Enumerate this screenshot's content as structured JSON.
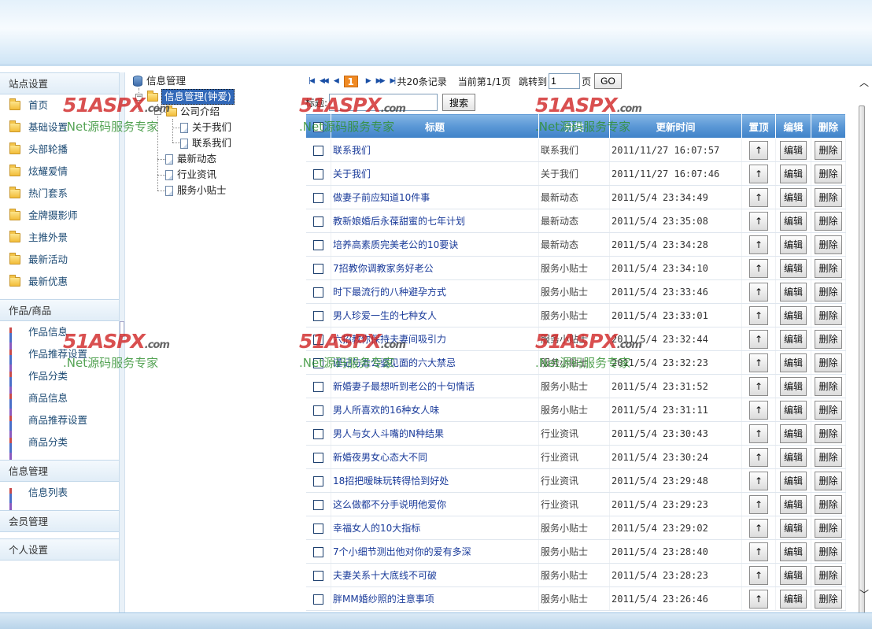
{
  "sidebar": {
    "sections": [
      {
        "title": "站点设置",
        "icon": "folder-icon",
        "items": [
          "首页",
          "基础设置",
          "头部轮播",
          "炫耀爱情",
          "热门套系",
          "金牌摄影师",
          "主推外景",
          "最新活动",
          "最新优惠"
        ]
      },
      {
        "title": "作品/商品",
        "icon": "bar-chart-icon",
        "items": [
          "作品信息",
          "作品推荐设置",
          "作品分类",
          "商品信息",
          "商品推荐设置",
          "商品分类"
        ]
      },
      {
        "title": "信息管理",
        "icon": "bar-chart-icon",
        "items": [
          "信息列表"
        ]
      },
      {
        "title": "会员管理",
        "items": []
      },
      {
        "title": "个人设置",
        "items": []
      }
    ]
  },
  "tree": {
    "root": "信息管理",
    "selected": "信息管理(钟爱)",
    "folder": "公司介绍",
    "folder_children": [
      "关于我们",
      "联系我们"
    ],
    "others": [
      "最新动态",
      "行业资讯",
      "服务小贴士"
    ]
  },
  "pager": {
    "first": "⏮",
    "prev_all": "◀◀",
    "prev": "◀",
    "current": "1",
    "next": "▶",
    "next_all": "▶▶",
    "last": "⏭",
    "total": "共20条记录",
    "current_text": "当前第1/1页",
    "jump_label": "跳转到",
    "jump_value": "1",
    "page_unit": "页",
    "go": "GO"
  },
  "search": {
    "label": "标题:",
    "value": "",
    "button": "搜索"
  },
  "table": {
    "headers": [
      "",
      "标题",
      "分类",
      "更新时间",
      "置顶",
      "编辑",
      "删除"
    ],
    "up_label": "↑",
    "edit_label": "编辑",
    "delete_label": "删除",
    "rows": [
      {
        "title": "联系我们",
        "category": "联系我们",
        "time": "2011/11/27 16:07:57"
      },
      {
        "title": "关于我们",
        "category": "关于我们",
        "time": "2011/11/27 16:07:46"
      },
      {
        "title": "做妻子前应知道10件事",
        "category": "最新动态",
        "time": "2011/5/4 23:34:49"
      },
      {
        "title": "教新娘婚后永葆甜蜜的七年计划",
        "category": "最新动态",
        "time": "2011/5/4 23:35:08"
      },
      {
        "title": "培养高素质完美老公的10要诀",
        "category": "最新动态",
        "time": "2011/5/4 23:34:28"
      },
      {
        "title": "7招教你调教家务好老公",
        "category": "服务小贴士",
        "time": "2011/5/4 23:34:10"
      },
      {
        "title": "时下最流行的八种避孕方式",
        "category": "服务小贴士",
        "time": "2011/5/4 23:33:46"
      },
      {
        "title": "男人珍爱一生的七种女人",
        "category": "服务小贴士",
        "time": "2011/5/4 23:33:01"
      },
      {
        "title": "六招教你保持夫妻间吸引力",
        "category": "服务小贴士",
        "time": "2011/5/4 23:32:44"
      },
      {
        "title": "谨记与准公婆见面的六大禁忌",
        "category": "服务小贴士",
        "time": "2011/5/4 23:32:23"
      },
      {
        "title": "新婚妻子最想听到老公的十句情话",
        "category": "服务小贴士",
        "time": "2011/5/4 23:31:52"
      },
      {
        "title": "男人所喜欢的16种女人味",
        "category": "服务小贴士",
        "time": "2011/5/4 23:31:11"
      },
      {
        "title": "男人与女人斗嘴的N种结果",
        "category": "行业资讯",
        "time": "2011/5/4 23:30:43"
      },
      {
        "title": "新婚夜男女心态大不同",
        "category": "行业资讯",
        "time": "2011/5/4 23:30:24"
      },
      {
        "title": "18招把暧昧玩转得恰到好处",
        "category": "行业资讯",
        "time": "2011/5/4 23:29:48"
      },
      {
        "title": "这么做都不分手说明他爱你",
        "category": "行业资讯",
        "time": "2011/5/4 23:29:23"
      },
      {
        "title": "幸福女人的10大指标",
        "category": "服务小贴士",
        "time": "2011/5/4 23:29:02"
      },
      {
        "title": "7个小细节测出他对你的爱有多深",
        "category": "服务小贴士",
        "time": "2011/5/4 23:28:40"
      },
      {
        "title": "夫妻关系十大底线不可破",
        "category": "服务小贴士",
        "time": "2011/5/4 23:28:23"
      },
      {
        "title": "胖MM婚纱照的注意事项",
        "category": "服务小贴士",
        "time": "2011/5/4 23:26:46"
      }
    ]
  },
  "watermark": {
    "brand": "51ASPX",
    "brand_suffix": ".com",
    "tagline": ".Net源码服务专家",
    "color_brand": "#d12a2a",
    "color_tagline": "#2f8f2f"
  },
  "scrollbar": {
    "up": "︿",
    "down": "﹀"
  }
}
